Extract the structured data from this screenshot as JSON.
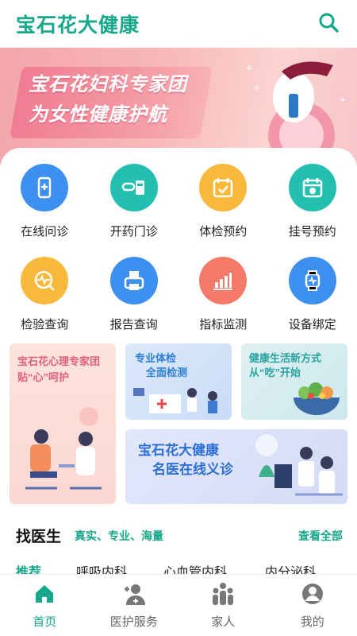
{
  "header": {
    "title": "宝石花大健康",
    "search_icon": "search-icon"
  },
  "banner": {
    "line1": "宝石花妇科专家团",
    "line2": "为女性健康护航",
    "dots": 5,
    "active_dot": 1
  },
  "services": [
    {
      "label": "在线问诊",
      "icon": "phone-plus-icon",
      "color": "#3d8ff0"
    },
    {
      "label": "开药门诊",
      "icon": "pills-icon",
      "color": "#24bfb0"
    },
    {
      "label": "体检预约",
      "icon": "calendar-check-icon",
      "color": "#f8b93a"
    },
    {
      "label": "挂号预约",
      "icon": "calendar-icon",
      "color": "#24bfb0"
    },
    {
      "label": "检验查询",
      "icon": "heartbeat-search-icon",
      "color": "#f8b93a"
    },
    {
      "label": "报告查询",
      "icon": "printer-report-icon",
      "color": "#3d8ff0"
    },
    {
      "label": "指标监测",
      "icon": "bar-chart-icon",
      "color": "#f57a6a"
    },
    {
      "label": "设备绑定",
      "icon": "smartwatch-icon",
      "color": "#3d8ff0"
    }
  ],
  "promos": {
    "psych": {
      "line1": "宝石花心理专家团",
      "line2": "贴“心”呵护"
    },
    "checkup": {
      "line1": "专业体检",
      "line2": "全面检测"
    },
    "diet": {
      "line1": "健康生活新方式",
      "line2": "从“吃”开始"
    },
    "online": {
      "line1": "宝石花大健康",
      "line2": "名医在线义诊"
    }
  },
  "find_doctor": {
    "title": "找医生",
    "tagline": "真实、专业、海量",
    "view_all": "查看全部",
    "tabs": [
      "推荐",
      "呼吸内科",
      "心血管内科",
      "内分泌科"
    ]
  },
  "bottom_nav": [
    {
      "label": "首页",
      "icon": "home-icon",
      "active": true
    },
    {
      "label": "医护服务",
      "icon": "medical-staff-icon",
      "active": false
    },
    {
      "label": "家人",
      "icon": "family-icon",
      "active": false
    },
    {
      "label": "我的",
      "icon": "profile-icon",
      "active": false
    }
  ],
  "colors": {
    "accent": "#17a88c",
    "blue": "#3d8ff0",
    "yellow": "#f8b93a",
    "coral": "#f57a6a"
  }
}
